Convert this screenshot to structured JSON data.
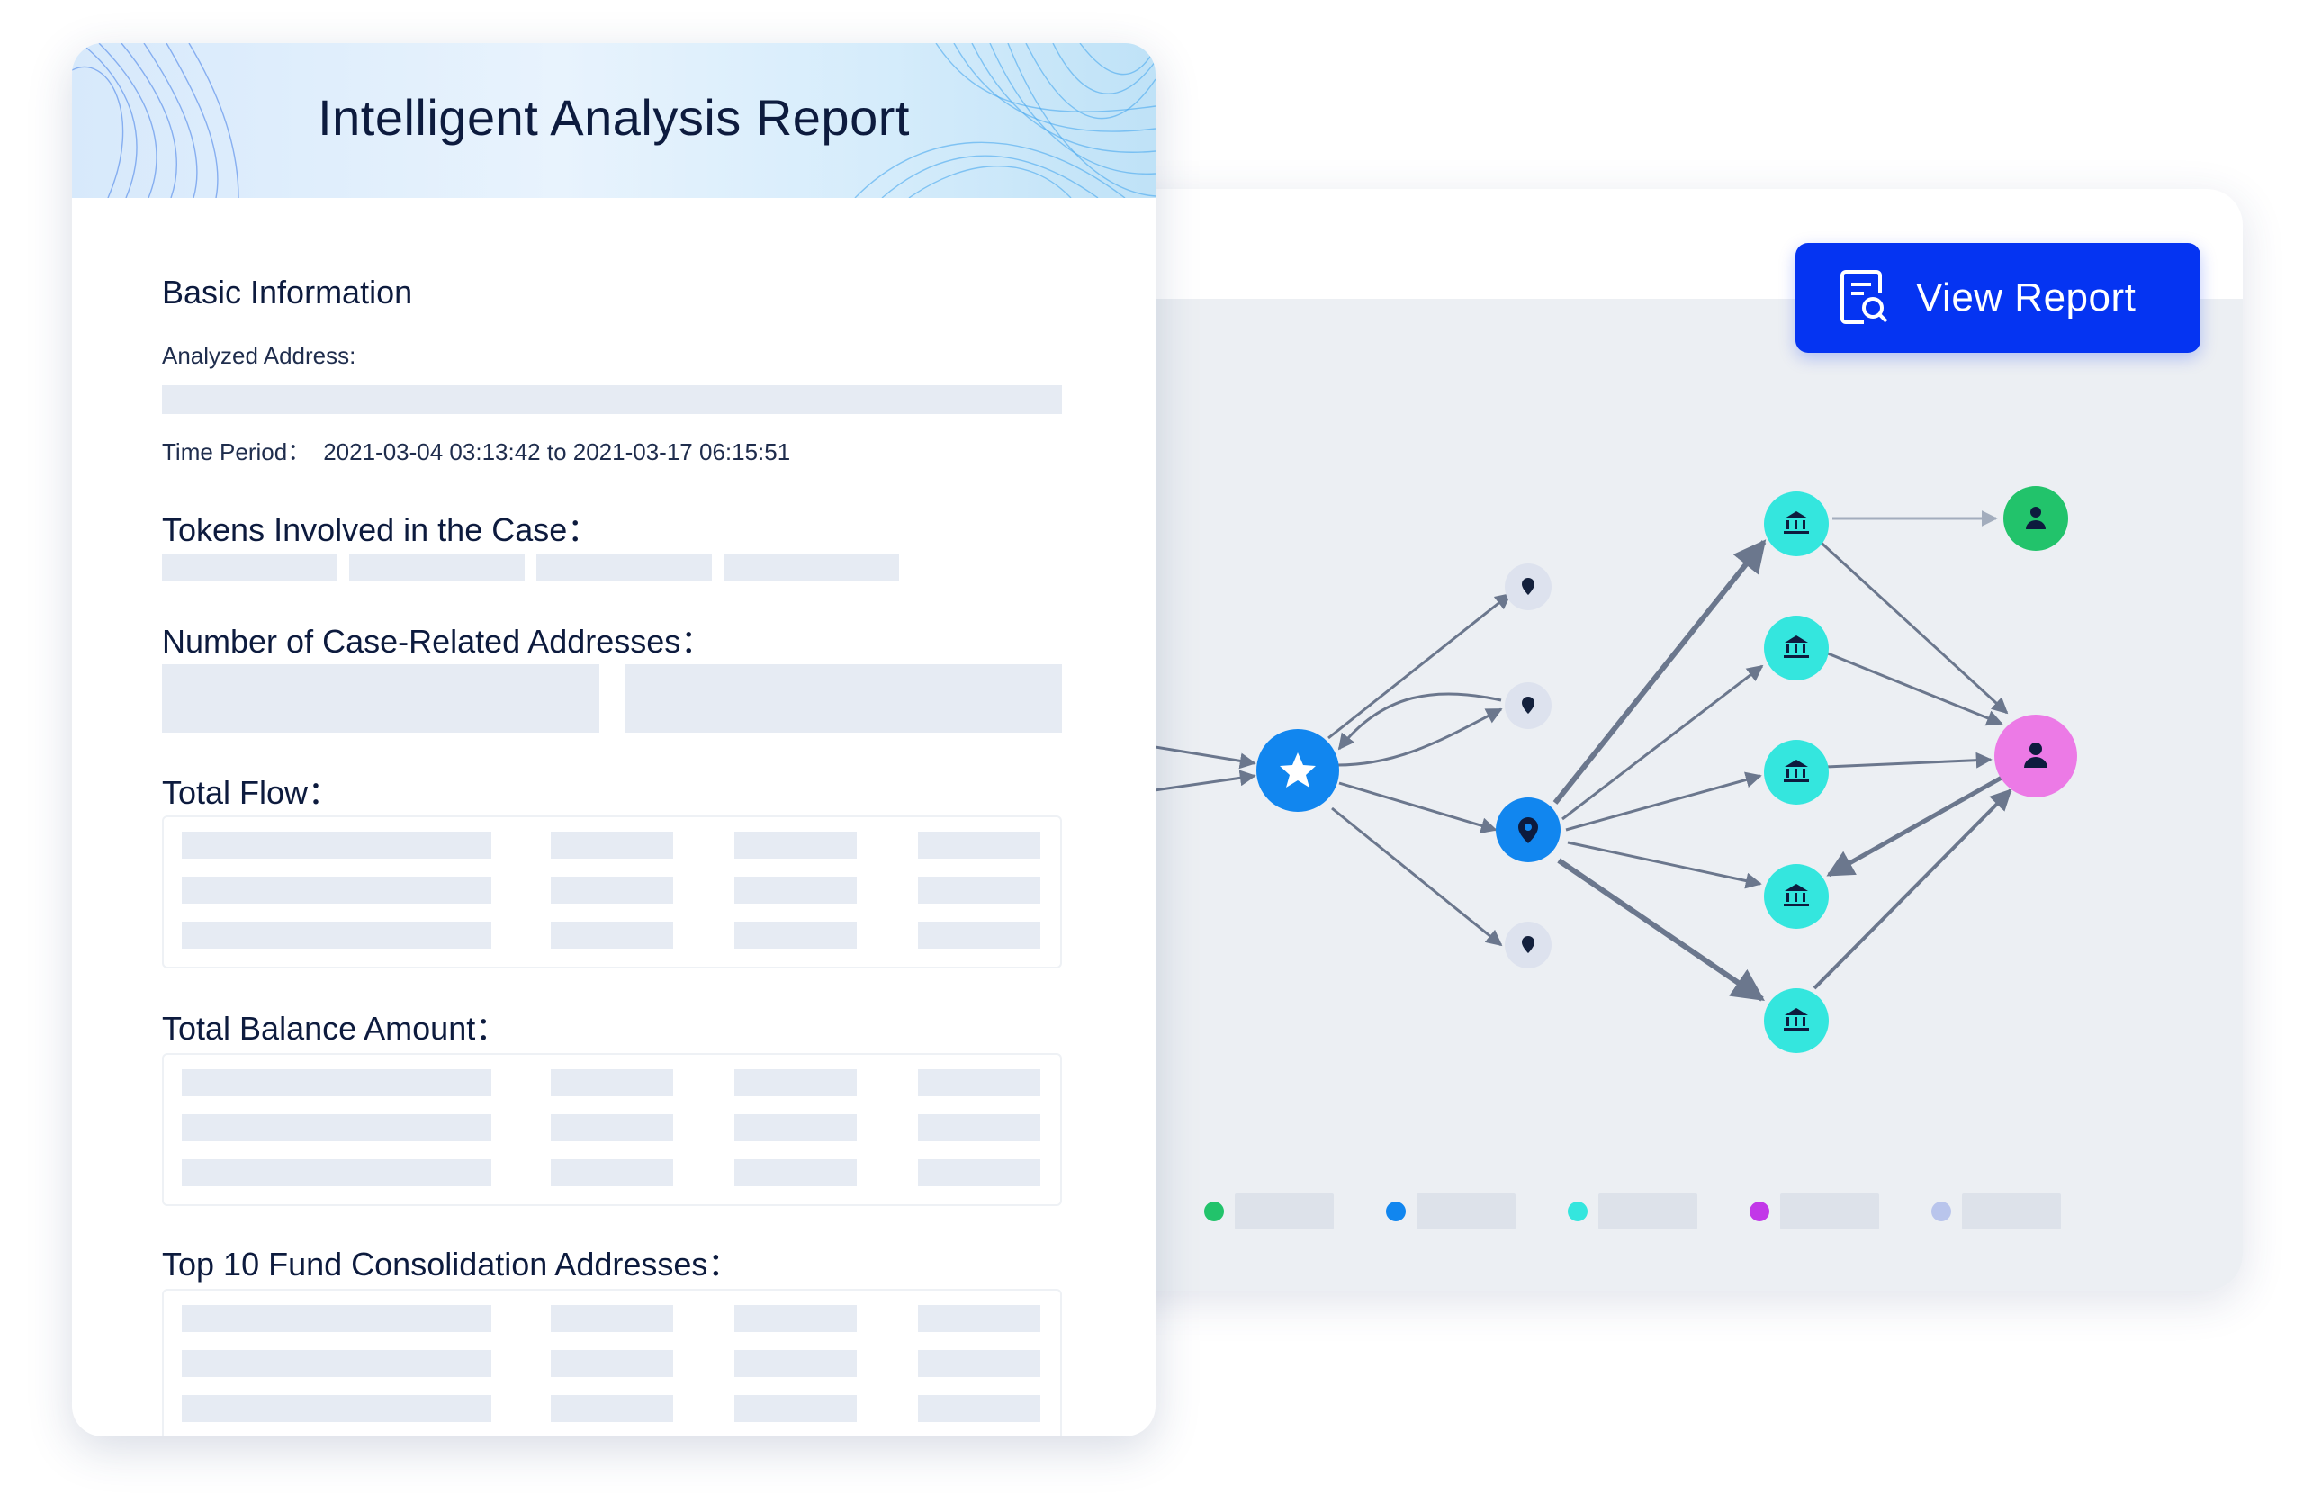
{
  "report": {
    "title": "Intelligent Analysis Report",
    "basic_info_title": "Basic Information",
    "analyzed_address_label": "Analyzed Address:",
    "time_period_label": "Time Period：",
    "time_period_value": "2021-03-04 03:13:42 to 2021-03-17 06:15:51",
    "tokens_title": "Tokens Involved in the Case：",
    "addresses_count_title": "Number of Case-Related Addresses：",
    "total_flow_title": "Total Flow：",
    "total_balance_title": "Total Balance Amount：",
    "top10_title": "Top 10 Fund Consolidation Addresses："
  },
  "graph_panel": {
    "view_report_label": "View Report",
    "view_report_icon": "report-search-icon",
    "node_icons": {
      "center": "star-icon",
      "address": "location-pin-icon",
      "exchange": "bank-icon",
      "entity": "user-icon"
    },
    "legend_colors": [
      "#22c36b",
      "#1186ef",
      "#34e6de",
      "#c238e8",
      "#b9c5ec"
    ]
  },
  "colors": {
    "accent_blue": "#0534f2",
    "node_blue": "#1186ef",
    "node_cyan": "#34e6de",
    "node_green": "#22c36b",
    "node_pink": "#ec7ae6",
    "node_grey": "#dde2ee",
    "edge": "#6b778d",
    "placeholder": "#e6ebf3"
  }
}
